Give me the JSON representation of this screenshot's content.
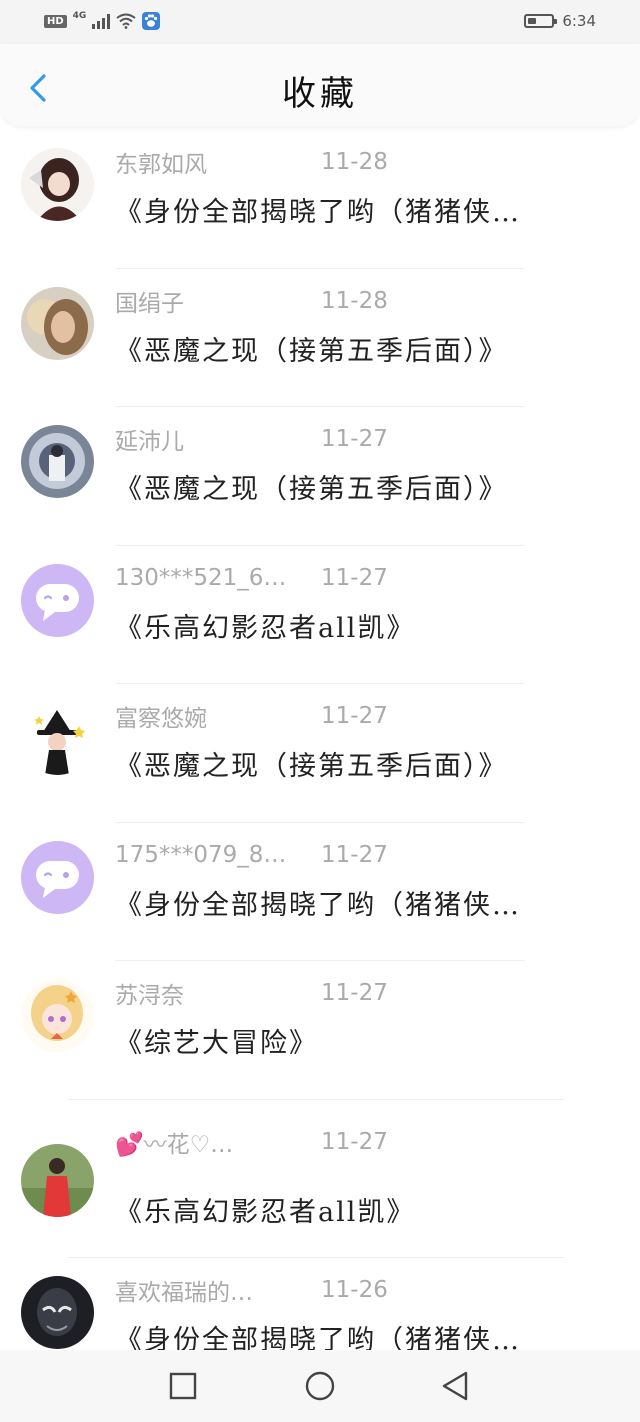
{
  "status_bar": {
    "network_badge": "HD",
    "network_type": "4G",
    "time": "6:34",
    "icons": [
      "signal-icon",
      "wifi-icon",
      "paw-icon",
      "battery-icon"
    ]
  },
  "header": {
    "title": "收藏",
    "back_icon": "chevron-left-icon",
    "accent_color": "#2f9bea"
  },
  "items": [
    {
      "name": "东郭如风",
      "date": "11-28",
      "text": "《身份全部揭晓了哟（猪猪侠…",
      "avatar": "anime-girl-avatar"
    },
    {
      "name": "国绢子",
      "date": "11-28",
      "text": "《恶魔之现（接第五季后面）》",
      "avatar": "photo-avatar"
    },
    {
      "name": "延沛儿",
      "date": "11-27",
      "text": "《恶魔之现（接第五季后面）》",
      "avatar": "photo-avatar"
    },
    {
      "name": "130***521_6…",
      "date": "11-27",
      "text": "《乐高幻影忍者all凯》",
      "avatar": "default-chat-avatar"
    },
    {
      "name": "富察悠婉",
      "date": "11-27",
      "text": "《恶魔之现（接第五季后面）》",
      "avatar": "witch-avatar"
    },
    {
      "name": "175***079_8…",
      "date": "11-27",
      "text": "《身份全部揭晓了哟（猪猪侠…",
      "avatar": "default-chat-avatar"
    },
    {
      "name": "苏浔奈",
      "date": "11-27",
      "text": "《综艺大冒险》",
      "avatar": "anime-girl-avatar"
    },
    {
      "name": "💕〰花♡…",
      "date": "11-27",
      "text": "《乐高幻影忍者all凯》",
      "avatar": "photo-avatar"
    },
    {
      "name": "喜欢福瑞的…",
      "date": "11-26",
      "text": "《身份全部揭晓了哟（猪猪侠…",
      "avatar": "dark-avatar"
    }
  ],
  "nav_bar": {
    "buttons": [
      "recent-apps-icon",
      "home-icon",
      "back-triangle-icon"
    ]
  },
  "default_avatar_color": "#cdb8f5"
}
